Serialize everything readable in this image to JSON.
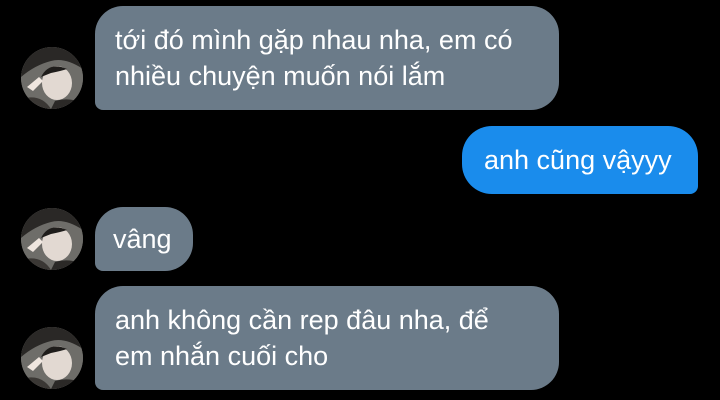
{
  "chat": {
    "messages": [
      {
        "direction": "incoming",
        "text": "tới đó mình gặp nhau nha, em có\nnhiều chuyện muốn nói lắm",
        "avatar": "user-avatar"
      },
      {
        "direction": "outgoing",
        "text": "anh cũng vậyyy"
      },
      {
        "direction": "incoming",
        "text": "vâng",
        "avatar": "user-avatar"
      },
      {
        "direction": "incoming",
        "text": "anh không cần rep đâu nha, để\nem nhắn cuối cho",
        "avatar": "user-avatar"
      }
    ]
  },
  "colors": {
    "background": "#000000",
    "incoming_bubble": "#6b7b89",
    "outgoing_bubble": "#1a8cec",
    "text": "#ffffff"
  }
}
